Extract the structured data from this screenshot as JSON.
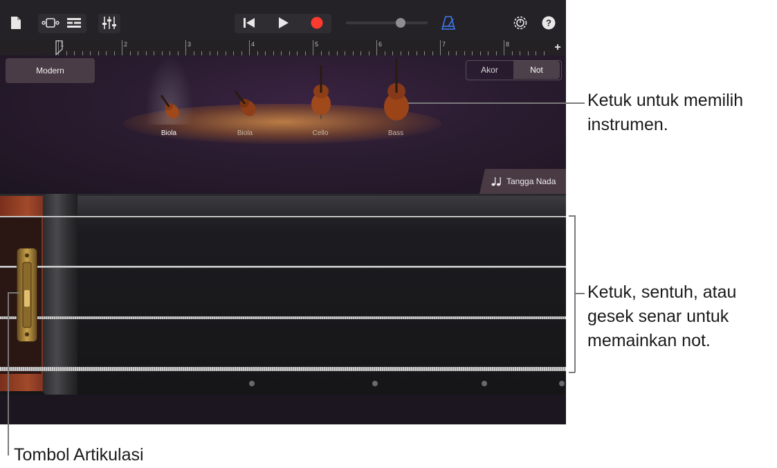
{
  "toolbar": {
    "icons": [
      "document-icon",
      "view-toggle-icon",
      "tracks-view-icon",
      "mixer-icon",
      "rewind-icon",
      "play-icon",
      "record-icon",
      "volume-slider",
      "metronome-icon",
      "settings-icon",
      "help-icon"
    ]
  },
  "ruler": {
    "bars": [
      "1",
      "2",
      "3",
      "4",
      "5",
      "6",
      "7",
      "8"
    ],
    "add_label": "+"
  },
  "stage": {
    "preset_label": "Modern",
    "mode_options": [
      "Akor",
      "Not"
    ],
    "selected_mode": "Not",
    "instruments": [
      "Biola",
      "Biola",
      "Cello",
      "Bass"
    ],
    "selected_instrument_index": 0
  },
  "scale_button": {
    "icon": "notes-icon",
    "label": "Tangga Nada"
  },
  "colors": {
    "record": "#ff3b30",
    "metronome": "#3d7bf5",
    "stage_glow": "#d28c46"
  },
  "callouts": {
    "choose_instrument": [
      "Ketuk untuk memilih",
      "instrumen."
    ],
    "strings": [
      "Ketuk, sentuh, atau",
      "gesek senar untuk",
      "memainkan not."
    ],
    "articulation": "Tombol Artikulasi"
  }
}
